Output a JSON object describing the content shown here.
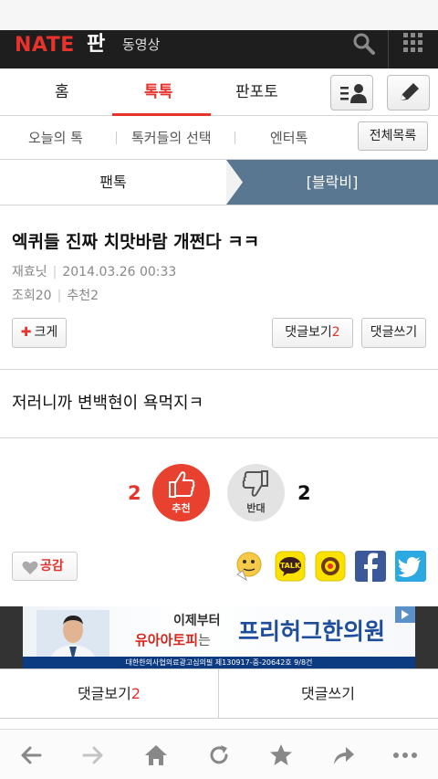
{
  "header": {
    "logo": "NATE",
    "section": "판",
    "video_label": "동영상"
  },
  "tabs": [
    {
      "label": "홈",
      "active": false
    },
    {
      "label": "톡톡",
      "active": true
    },
    {
      "label": "판포토",
      "active": false
    }
  ],
  "icons": {
    "profile": "profile-menu-icon",
    "write": "pencil-icon",
    "search": "search-icon",
    "apps": "grid-icon"
  },
  "subnav": {
    "items": [
      "오늘의 톡",
      "톡커들의 선택",
      "엔터톡"
    ],
    "full_list": "전체목록"
  },
  "board": {
    "left": "팬톡",
    "right": "[블락비]"
  },
  "post": {
    "title": "엑퀴들 진짜 치맛바람 개쩐다 ㅋㅋ",
    "author": "재효닛",
    "datetime": "2014.03.26 00:33",
    "views_label": "조회",
    "views": "20",
    "recommend_label": "추천",
    "recommend": "2",
    "enlarge_label": "크게",
    "view_comments_label": "댓글보기",
    "comment_count": "2",
    "write_comment_label": "댓글쓰기",
    "body": "저러니까 변백현이 욕먹지ㅋ"
  },
  "vote": {
    "up_count": "2",
    "up_label": "추천",
    "down_label": "반대",
    "down_count": "2"
  },
  "share": {
    "empathy_label": "공감",
    "targets": [
      "nate-on",
      "kakaotalk",
      "kakaostory",
      "facebook",
      "twitter"
    ]
  },
  "ad": {
    "line1": "이제부터",
    "line2_highlight": "유아아토피",
    "line2_suffix": "는",
    "brand": "프리허그한의원",
    "fine_print": "대한한의사협의료광고심의필 제130917-중-20642호 9/8건"
  },
  "bottom_actions": {
    "view_comments": "댓글보기",
    "comment_count": "2",
    "write_comment": "댓글쓰기"
  },
  "colors": {
    "accent": "#e8322c",
    "header_bg": "#1e1e1e",
    "board_tab": "#5a7791",
    "facebook": "#3b5998",
    "twitter": "#2ca9e1",
    "kakao": "#fae100"
  }
}
